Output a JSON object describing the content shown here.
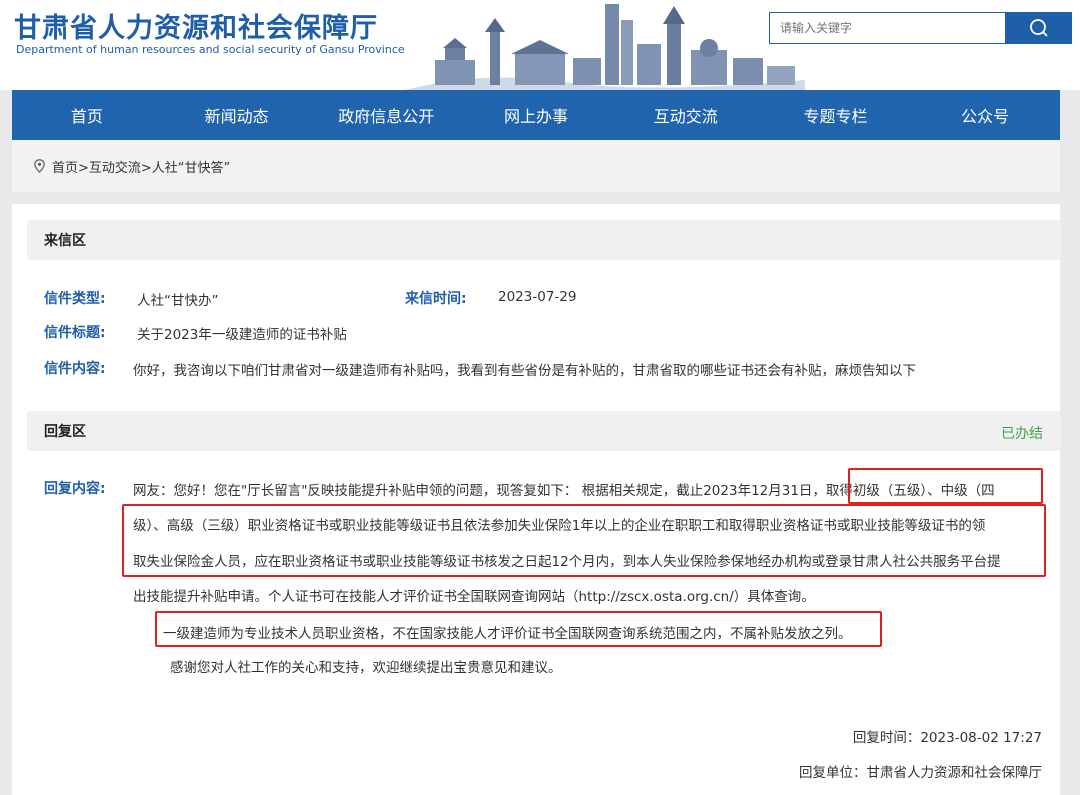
{
  "header": {
    "title_cn": "甘肃省人力资源和社会保障厅",
    "title_en": "Department of human resources and social security of Gansu Province",
    "search_placeholder": "请输入关键字"
  },
  "nav": {
    "items": [
      "首页",
      "新闻动态",
      "政府信息公开",
      "网上办事",
      "互动交流",
      "专题专栏",
      "公众号"
    ]
  },
  "breadcrumb": {
    "text": "首页>互动交流>人社“甘快答”"
  },
  "letter": {
    "section_title": "来信区",
    "type_label": "信件类型:",
    "type_value": "人社“甘快办”",
    "time_label": "来信时间:",
    "time_value": "2023-07-29",
    "subject_label": "信件标题:",
    "subject_value": "关于2023年一级建造师的证书补贴",
    "content_label": "信件内容:",
    "content_value": "你好，我咨询以下咱们甘肃省对一级建造师有补贴吗，我看到有些省份是有补贴的，甘肃省取的哪些证书还会有补贴，麻烦告知以下"
  },
  "reply": {
    "section_title": "回复区",
    "status": "已办结",
    "content_label": "回复内容:",
    "lines": [
      "网友：您好！您在\"厅长留言\"反映技能提升补贴申领的问题，现答复如下：  根据相关规定，截止2023年12月31日，取得初级（五级）、中级（四",
      "级）、高级（三级）职业资格证书或职业技能等级证书且依法参加失业保险1年以上的企业在职职工和取得职业资格证书或职业技能等级证书的领",
      "取失业保险金人员，应在职业资格证书或职业技能等级证书核发之日起12个月内，到本人失业保险参保地经办机构或登录甘肃人社公共服务平台提",
      "出技能提升补贴申请。个人证书可在技能人才评价证书全国联网查询网站（http://zscx.osta.org.cn/）具体查询。"
    ],
    "note": "一级建造师为专业技术人员职业资格，不在国家技能人才评价证书全国联网查询系统范围之内，不属补贴发放之列。",
    "thanks": "感谢您对人社工作的关心和支持，欢迎继续提出宝贵意见和建议。",
    "reply_time": "回复时间：2023-08-02 17:27",
    "reply_unit": "回复单位：甘肃省人力资源和社会保障厅"
  },
  "colors": {
    "brand_blue": "#1f64ad",
    "highlight_red": "#e02020",
    "status_green": "#3ea24a"
  },
  "icons": [
    "search-icon",
    "location-pin-icon",
    "skyline-illustration"
  ]
}
